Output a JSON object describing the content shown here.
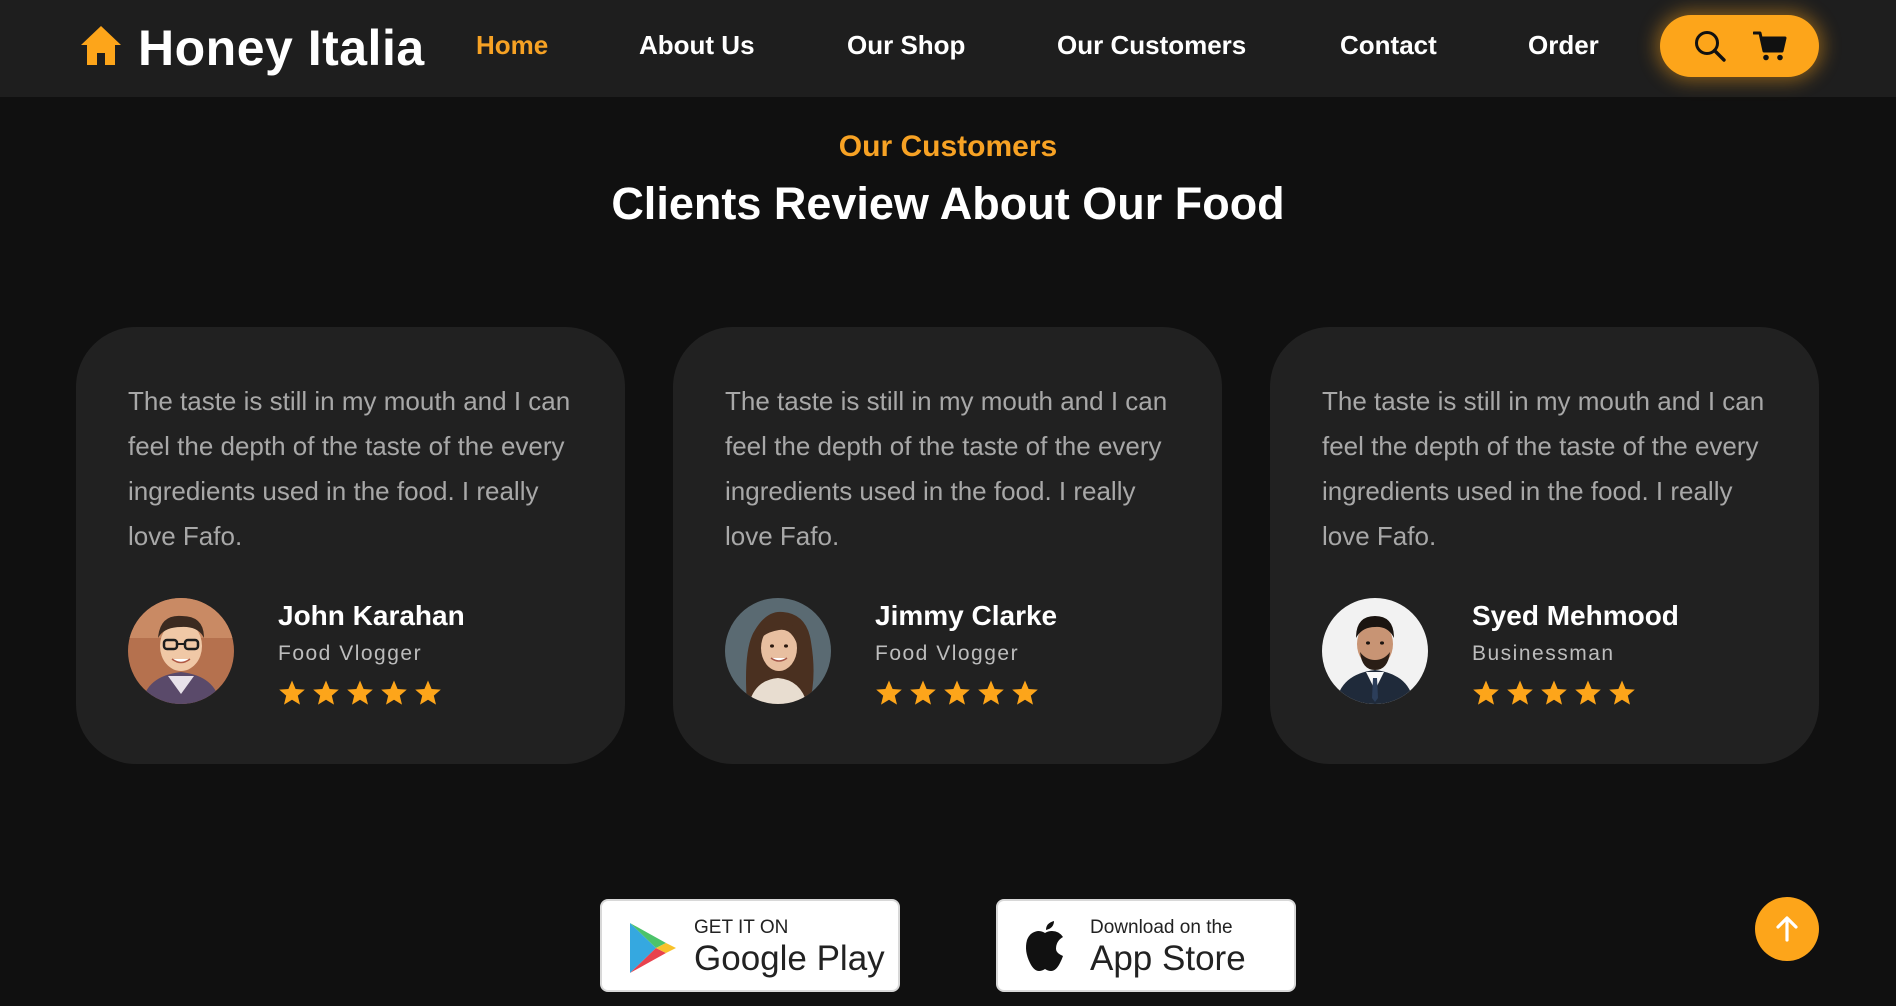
{
  "brand": {
    "name": "Honey Italia",
    "icon": "home-icon"
  },
  "nav": {
    "items": [
      {
        "label": "Home",
        "active": true
      },
      {
        "label": "About Us",
        "active": false
      },
      {
        "label": "Our Shop",
        "active": false
      },
      {
        "label": "Our Customers",
        "active": false
      },
      {
        "label": "Contact",
        "active": false
      },
      {
        "label": "Order",
        "active": false
      }
    ],
    "pill_icons": [
      "search-icon",
      "cart-icon"
    ]
  },
  "section": {
    "subtitle": "Our Customers",
    "title": "Clients Review About Our Food"
  },
  "reviews": [
    {
      "text": "The taste is still in my mouth and I can feel the depth of the taste of the every ingredients used in the food. I really love Fafo.",
      "name": "John Karahan",
      "role": "Food Vlogger",
      "rating": 5
    },
    {
      "text": "The taste is still in my mouth and I can feel the depth of the taste of the every ingredients used in the food. I really love Fafo.",
      "name": "Jimmy Clarke",
      "role": "Food Vlogger",
      "rating": 5
    },
    {
      "text": "The taste is still in my mouth and I can feel the depth of the taste of the every ingredients used in the food. I really love Fafo.",
      "name": "Syed Mehmood",
      "role": "Businessman",
      "rating": 5
    }
  ],
  "store_badges": {
    "google": {
      "small": "GET IT ON",
      "big": "Google Play"
    },
    "apple": {
      "small": "Download on the",
      "big": "App Store"
    }
  },
  "colors": {
    "accent": "#fda51a",
    "background": "#101010",
    "navbar": "#1e1e1e",
    "card": "#212121"
  }
}
